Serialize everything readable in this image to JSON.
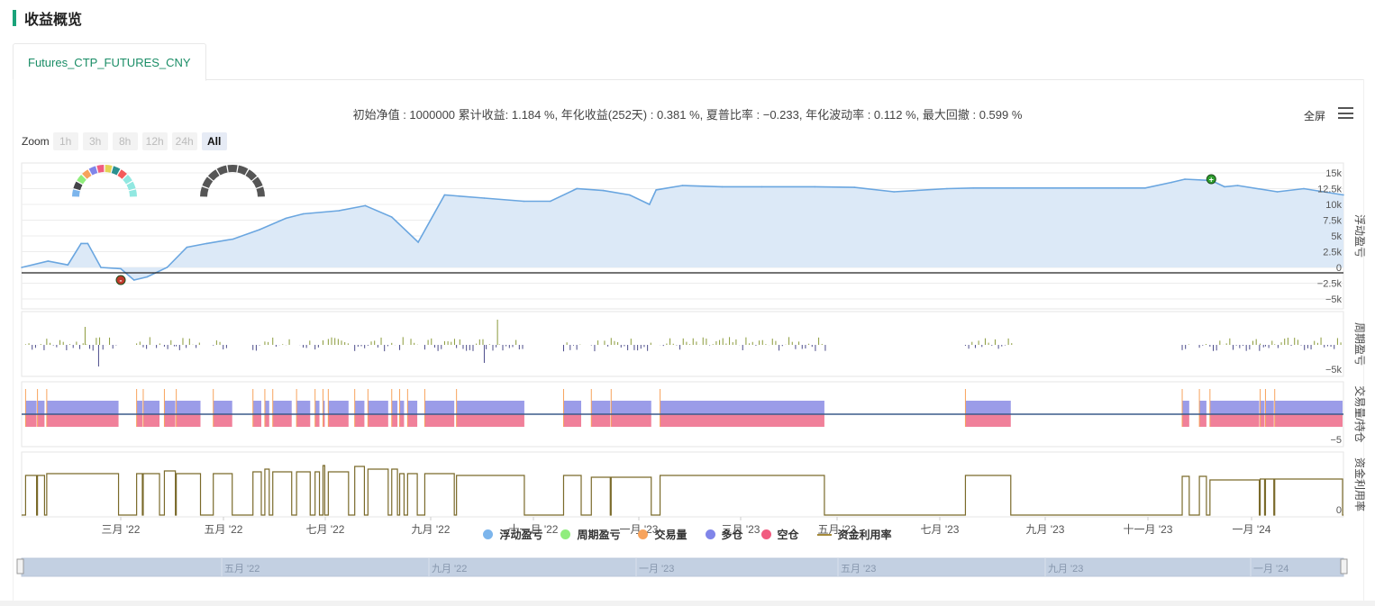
{
  "page": {
    "section_title": "收益概览",
    "tab_label": "Futures_CTP_FUTURES_CNY",
    "stats_text": "初始净值 : 1000000 累计收益: 1.184 %, 年化收益(252天) : 0.381 %, 夏普比率 : −0.233, 年化波动率 : 0.112 %, 最大回撤 : 0.599 %",
    "fullscreen_label": "全屏",
    "menu_icon": "hamburger-icon",
    "zoom_label": "Zoom",
    "zoom_buttons": [
      "1h",
      "3h",
      "8h",
      "12h",
      "24h",
      "All"
    ],
    "zoom_active": "All"
  },
  "legend": [
    {
      "label": "浮动盈亏",
      "color": "#7cb5ec",
      "shape": "dot"
    },
    {
      "label": "周期盈亏",
      "color": "#90ed7d",
      "shape": "dot"
    },
    {
      "label": "交易量",
      "color": "#f7a35c",
      "shape": "dot"
    },
    {
      "label": "多仓",
      "color": "#8085e9",
      "shape": "dot"
    },
    {
      "label": "空仓",
      "color": "#f15c80",
      "shape": "dot"
    },
    {
      "label": "资金利用率",
      "color": "#a58a3a",
      "shape": "line"
    }
  ],
  "navigator": {
    "labels": [
      "五月 '22",
      "九月 '22",
      "一月 '23",
      "五月 '23",
      "九月 '23",
      "一月 '24"
    ]
  },
  "chart_data": {
    "type": "line",
    "x_labels": [
      "三月 '22",
      "五月 '22",
      "七月 '22",
      "九月 '22",
      "十一月 '22",
      "一月 '23",
      "三月 '23",
      "五月 '23",
      "七月 '23",
      "九月 '23",
      "十一月 '23",
      "一月 '24"
    ],
    "panes": [
      {
        "name": "浮动盈亏",
        "type": "area",
        "ylabel": "浮动盈亏",
        "ylim": [
          -5000,
          15000
        ],
        "y_ticks": [
          "15k",
          "12.5k",
          "10k",
          "7.5k",
          "5k",
          "2.5k",
          "0",
          "−2.5k",
          "−5k"
        ],
        "x": [
          0,
          0.02,
          0.035,
          0.045,
          0.05,
          0.06,
          0.075,
          0.085,
          0.095,
          0.11,
          0.125,
          0.14,
          0.16,
          0.18,
          0.2,
          0.213,
          0.24,
          0.26,
          0.28,
          0.3,
          0.32,
          0.35,
          0.38,
          0.4,
          0.42,
          0.44,
          0.46,
          0.475,
          0.48,
          0.5,
          0.53,
          0.56,
          0.6,
          0.63,
          0.66,
          0.7,
          0.72,
          0.75,
          0.78,
          0.8,
          0.83,
          0.85,
          0.87,
          0.88,
          0.9,
          0.91,
          0.92,
          0.95,
          0.97,
          1.0
        ],
        "values": [
          0,
          1000,
          400,
          3800,
          3800,
          0,
          -200,
          -2000,
          -1500,
          0,
          3200,
          3800,
          4500,
          6000,
          7800,
          8500,
          9000,
          9800,
          8000,
          4000,
          11500,
          11000,
          10500,
          10500,
          12500,
          12200,
          11500,
          10000,
          12300,
          13000,
          12800,
          12800,
          12800,
          12700,
          12000,
          12500,
          12600,
          12600,
          12600,
          12600,
          12600,
          12600,
          13500,
          14000,
          13800,
          12800,
          13000,
          12000,
          12500,
          11500
        ],
        "markers": [
          {
            "label": "-",
            "x": 0.075,
            "value": -2000
          },
          {
            "label": "+",
            "x": 0.9,
            "value": 14000
          }
        ]
      },
      {
        "name": "周期盈亏",
        "type": "bar",
        "ylabel": "周期盈亏",
        "y_ticks": [
          "−5k"
        ]
      },
      {
        "name": "交易量/持仓",
        "type": "bar",
        "ylabel": "交易量/持仓",
        "y_ticks": [
          "−5"
        ]
      },
      {
        "name": "资金利用率",
        "type": "line",
        "ylabel": "资金利用率",
        "y_ticks": [
          "0"
        ]
      }
    ]
  }
}
